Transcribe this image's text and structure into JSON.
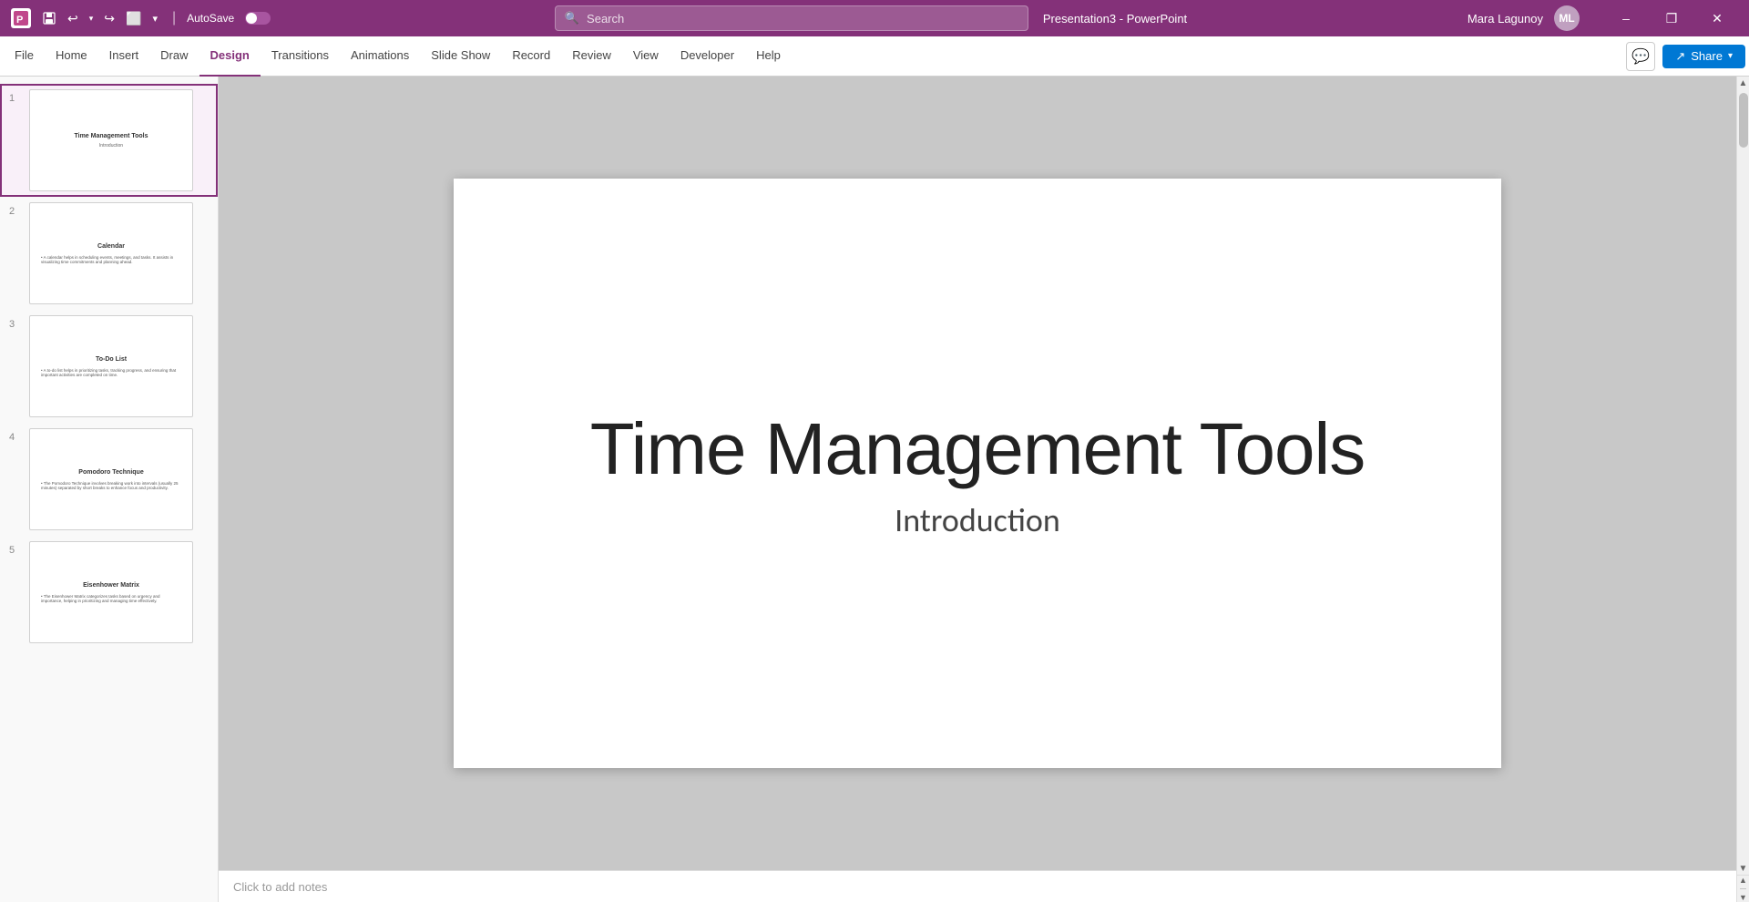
{
  "titlebar": {
    "app_name": "PowerPoint",
    "presentation_name": "Presentation3",
    "separator": "-",
    "autosave_label": "AutoSave",
    "user_name": "Mara Lagunoy",
    "user_initials": "ML",
    "search_placeholder": "Search",
    "min_label": "–",
    "restore_label": "❐",
    "close_label": "✕"
  },
  "ribbon": {
    "tabs": [
      {
        "id": "file",
        "label": "File"
      },
      {
        "id": "home",
        "label": "Home"
      },
      {
        "id": "insert",
        "label": "Insert"
      },
      {
        "id": "draw",
        "label": "Draw"
      },
      {
        "id": "design",
        "label": "Design"
      },
      {
        "id": "transitions",
        "label": "Transitions"
      },
      {
        "id": "animations",
        "label": "Animations"
      },
      {
        "id": "slideshow",
        "label": "Slide Show"
      },
      {
        "id": "record",
        "label": "Record"
      },
      {
        "id": "review",
        "label": "Review"
      },
      {
        "id": "view",
        "label": "View"
      },
      {
        "id": "developer",
        "label": "Developer"
      },
      {
        "id": "help",
        "label": "Help"
      }
    ],
    "active_tab": "design",
    "share_label": "Share",
    "comments_icon": "💬"
  },
  "slides": [
    {
      "number": 1,
      "title": "Time Management Tools",
      "subtitle": "Introduction",
      "active": true,
      "body_lines": []
    },
    {
      "number": 2,
      "title": "Calendar",
      "subtitle": "",
      "active": false,
      "body_lines": [
        "A calendar helps in scheduling events, meetings, and tasks. It assists in visualizing time commitments and planning ahead."
      ]
    },
    {
      "number": 3,
      "title": "To-Do List",
      "subtitle": "",
      "active": false,
      "body_lines": [
        "A to-do list helps in prioritizing tasks, tracking progress, and ensuring that important activities are completed on time."
      ]
    },
    {
      "number": 4,
      "title": "Pomodoro Technique",
      "subtitle": "",
      "active": false,
      "body_lines": [
        "The Pomodoro Technique involves breaking work into intervals (usually 25 minutes) separated by short breaks to enhance focus and productivity."
      ]
    },
    {
      "number": 5,
      "title": "Eisenhower Matrix",
      "subtitle": "",
      "active": false,
      "body_lines": [
        "The Eisenhower Matrix categorizes tasks based on urgency and importance, helping in prioritizing and managing time effectively."
      ]
    }
  ],
  "main_slide": {
    "title": "Time Management Tools",
    "subtitle": "Introduction"
  },
  "notes": {
    "placeholder": "Click to add notes"
  },
  "colors": {
    "brand": "#843179",
    "accent": "#0078d4",
    "active_tab_color": "#843179"
  }
}
